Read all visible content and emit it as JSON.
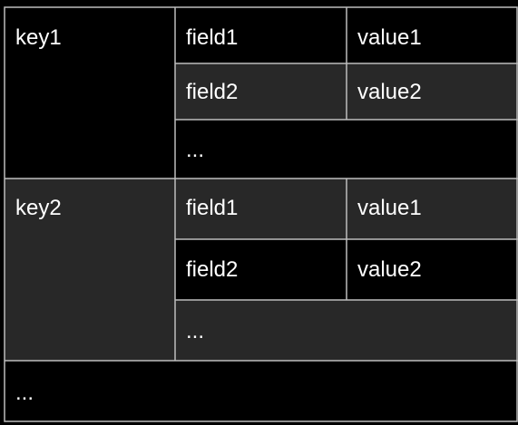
{
  "colors": {
    "background": "#000000",
    "cell_dark": "#000000",
    "cell_gray": "#282828",
    "border": "#bdbdbd",
    "text": "#ffffff"
  },
  "table": {
    "groups": [
      {
        "key": "key1",
        "rows": [
          {
            "field": "field1",
            "value": "value1"
          },
          {
            "field": "field2",
            "value": "value2"
          }
        ],
        "more": "..."
      },
      {
        "key": "key2",
        "rows": [
          {
            "field": "field1",
            "value": "value1"
          },
          {
            "field": "field2",
            "value": "value2"
          }
        ],
        "more": "..."
      }
    ],
    "more": "..."
  }
}
